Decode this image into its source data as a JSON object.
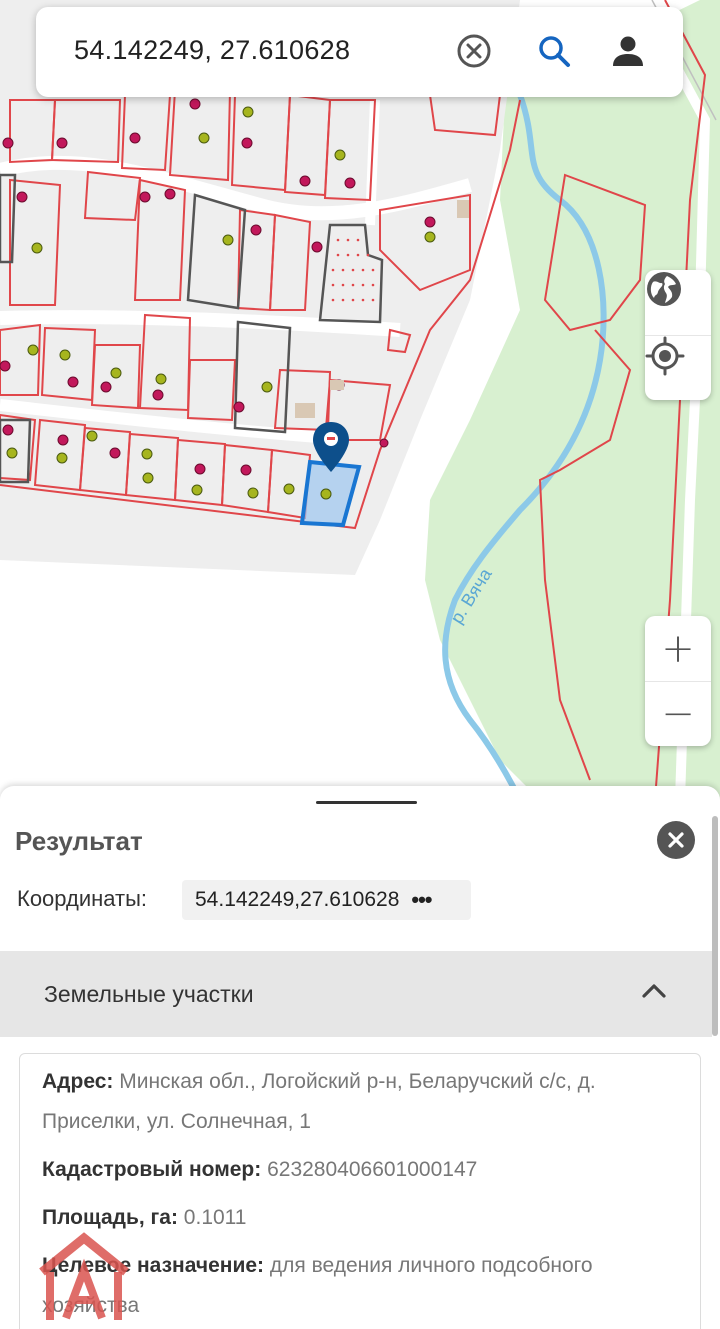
{
  "search": {
    "value": "54.142249, 27.610628"
  },
  "map": {
    "river_label": "р. Вяча",
    "colors": {
      "parcel_line": "#e0464a",
      "forest": "#d8f0d0",
      "river": "#8cc9e8",
      "selected": "#1976d2",
      "marker": "#0d4f8b"
    }
  },
  "map_buttons": {
    "layers_icon": "globe-icon",
    "locate_icon": "my-location-icon",
    "zoom_in": "+",
    "zoom_out": "−"
  },
  "result": {
    "title": "Результат",
    "coords_label": "Координаты:",
    "coords_value": "54.142249,27.610628",
    "coords_more": "•••"
  },
  "land": {
    "section_title": "Земельные участки",
    "address_key": "Адрес:",
    "address_value": " Минская обл., Логойский р-н, Беларучский с/с, д. Приселки, ул. Солнечная, 1",
    "cadastral_key": "Кадастровый номер:",
    "cadastral_value": " 623280406601000147",
    "area_key": "Площадь, га:",
    "area_value": " 0.1011",
    "purpose_key": "Целевое назначение:",
    "purpose_value": " для ведения личного подсобного хозяйства"
  }
}
